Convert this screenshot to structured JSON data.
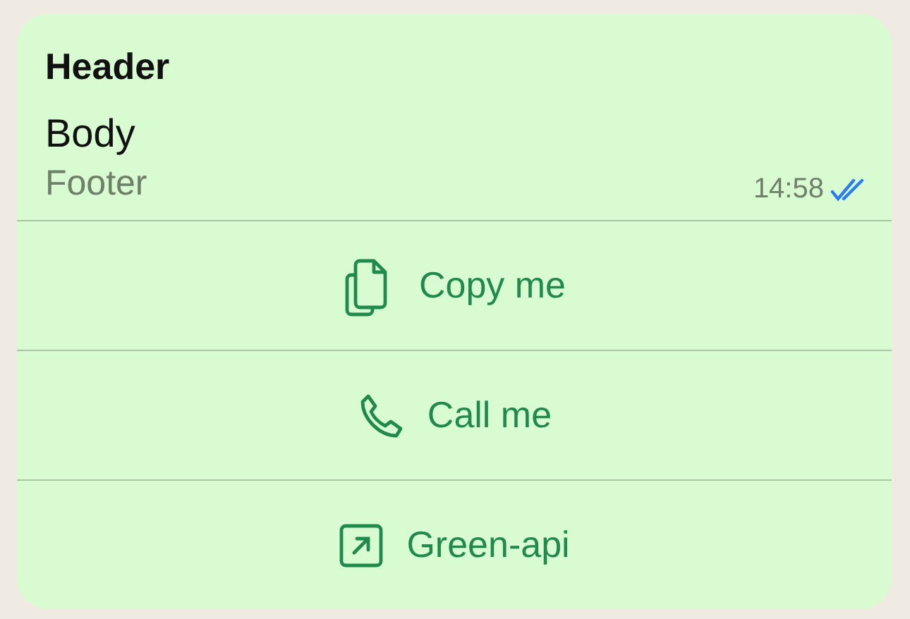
{
  "message": {
    "header": "Header",
    "body": "Body",
    "footer": "Footer",
    "time": "14:58",
    "read": true
  },
  "buttons": [
    {
      "kind": "copy",
      "label": "Copy me"
    },
    {
      "kind": "call",
      "label": "Call me"
    },
    {
      "kind": "url",
      "label": "Green-api"
    }
  ]
}
